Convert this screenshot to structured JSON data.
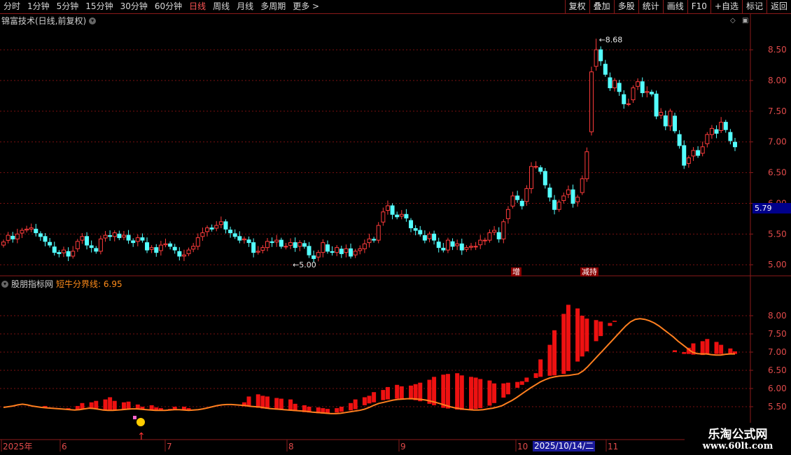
{
  "toolbar": {
    "periods": [
      "分时",
      "1分钟",
      "5分钟",
      "15分钟",
      "30分钟",
      "60分钟",
      "日线",
      "周线",
      "月线",
      "多周期",
      "更多 >"
    ],
    "active_period": "日线",
    "buttons": [
      "复权",
      "叠加",
      "多股",
      "统计",
      "画线",
      "F10",
      "+自选",
      "标记",
      "返回"
    ]
  },
  "main_panel": {
    "title": "锦富技术(日线,前复权)"
  },
  "sub_panel": {
    "name": "股朋指标网",
    "line_label": "短牛分界线: 6.95"
  },
  "current_price_tag": "5.79",
  "annotations": {
    "high": "8.68",
    "low": "5.00",
    "tag_zeng": "增",
    "tag_jigou": "减持"
  },
  "date_cursor": "2025/10/14/二",
  "watermark": {
    "line1": "乐淘公式网",
    "line2": "www.60lt.com"
  },
  "colors": {
    "up": "#ff3b3b",
    "down": "#54ffff",
    "bar": "#ee1111",
    "line": "#ff7f1f",
    "grid": "#7a1010"
  },
  "chart_data": [
    {
      "type": "candlestick",
      "title": "锦富技术(日线,前复权)",
      "y_ticks": [
        "8.50",
        "8.00",
        "7.50",
        "7.00",
        "6.50",
        "6.00",
        "5.50",
        "5.00"
      ],
      "ylim": [
        4.82,
        8.9
      ],
      "x_ticks": [
        "2025年",
        "6",
        "7",
        "8",
        "9",
        "10",
        "11"
      ],
      "series": [
        {
          "name": "K线",
          "close": [
            5.37,
            5.48,
            5.42,
            5.5,
            5.56,
            5.58,
            5.6,
            5.52,
            5.46,
            5.38,
            5.32,
            5.2,
            5.18,
            5.24,
            5.14,
            5.22,
            5.38,
            5.46,
            5.32,
            5.28,
            5.22,
            5.42,
            5.48,
            5.46,
            5.52,
            5.44,
            5.48,
            5.4,
            5.36,
            5.44,
            5.4,
            5.24,
            5.28,
            5.2,
            5.32,
            5.34,
            5.3,
            5.24,
            5.14,
            5.16,
            5.24,
            5.3,
            5.44,
            5.52,
            5.6,
            5.58,
            5.64,
            5.7,
            5.58,
            5.52,
            5.46,
            5.4,
            5.42,
            5.36,
            5.2,
            5.22,
            5.28,
            5.38,
            5.36,
            5.4,
            5.3,
            5.3,
            5.36,
            5.28,
            5.36,
            5.3,
            5.16,
            5.1,
            5.2,
            5.36,
            5.22,
            5.2,
            5.28,
            5.18,
            5.26,
            5.14,
            5.22,
            5.26,
            5.34,
            5.42,
            5.4,
            5.64,
            5.86,
            5.96,
            5.82,
            5.78,
            5.82,
            5.76,
            5.6,
            5.56,
            5.5,
            5.4,
            5.5,
            5.4,
            5.28,
            5.24,
            5.4,
            5.3,
            5.34,
            5.24,
            5.28,
            5.3,
            5.3,
            5.4,
            5.4,
            5.52,
            5.56,
            5.42,
            5.7,
            5.9,
            6.12,
            6.06,
            5.96,
            6.24,
            6.6,
            6.6,
            6.52,
            6.3,
            6.1,
            5.9,
            6.02,
            6.12,
            6.22,
            6.0,
            6.1,
            6.4,
            6.84,
            8.14,
            8.5,
            8.32,
            8.1,
            7.88,
            8.0,
            7.82,
            7.62,
            7.62,
            7.88,
            7.98,
            7.8,
            7.82,
            7.78,
            7.42,
            7.48,
            7.26,
            7.5,
            7.18,
            6.94,
            6.62,
            6.74,
            6.86,
            6.78,
            6.92,
            7.12,
            7.22,
            7.14,
            7.32,
            7.2,
            7.02,
            6.92
          ]
        }
      ],
      "high_annotation": 8.68,
      "low_annotation": 5.0
    },
    {
      "type": "bar",
      "title": "股朋指标网",
      "y_ticks": [
        "8.00",
        "7.50",
        "7.00",
        "6.50",
        "6.00",
        "5.50"
      ],
      "series": [
        {
          "name": "短牛分界线",
          "values": [
            5.48,
            5.5,
            5.52,
            5.55,
            5.57,
            5.55,
            5.52,
            5.5,
            5.48,
            5.47,
            5.46,
            5.45,
            5.44,
            5.43,
            5.42,
            5.41,
            5.42,
            5.44,
            5.46,
            5.45,
            5.43,
            5.41,
            5.4,
            5.4,
            5.41,
            5.42,
            5.43,
            5.44,
            5.44,
            5.43,
            5.42,
            5.41,
            5.4,
            5.4,
            5.4,
            5.41,
            5.42,
            5.42,
            5.41,
            5.4,
            5.41,
            5.42,
            5.44,
            5.47,
            5.5,
            5.53,
            5.55,
            5.56,
            5.56,
            5.55,
            5.54,
            5.53,
            5.51,
            5.5,
            5.49,
            5.47,
            5.45,
            5.44,
            5.43,
            5.42,
            5.41,
            5.4,
            5.39,
            5.38,
            5.37,
            5.35,
            5.34,
            5.33,
            5.32,
            5.31,
            5.31,
            5.32,
            5.34,
            5.36,
            5.38,
            5.4,
            5.43,
            5.48,
            5.54,
            5.59,
            5.62,
            5.65,
            5.68,
            5.7,
            5.71,
            5.72,
            5.72,
            5.71,
            5.7,
            5.68,
            5.65,
            5.62,
            5.58,
            5.54,
            5.5,
            5.47,
            5.45,
            5.43,
            5.42,
            5.41,
            5.41,
            5.42,
            5.44,
            5.46,
            5.49,
            5.53,
            5.6,
            5.67,
            5.75,
            5.84,
            5.93,
            6.02,
            6.1,
            6.18,
            6.24,
            6.29,
            6.32,
            6.34,
            6.35,
            6.36,
            6.38,
            6.4,
            6.48,
            6.6,
            6.74,
            6.88,
            7.02,
            7.16,
            7.3,
            7.44,
            7.58,
            7.72,
            7.83,
            7.9,
            7.92,
            7.9,
            7.86,
            7.8,
            7.72,
            7.62,
            7.52,
            7.42,
            7.3,
            7.2,
            7.1,
            7.0,
            6.96,
            6.95,
            6.95,
            6.93,
            6.92,
            6.92,
            6.94,
            6.95,
            6.95
          ]
        },
        {
          "name": "柱",
          "values": [
            5.48,
            5.46,
            5.4,
            5.5,
            5.44,
            5.46,
            5.52,
            5.46,
            5.42,
            5.4,
            5.46,
            5.52,
            5.6,
            5.62,
            5.66,
            5.7,
            5.76,
            5.66,
            5.62,
            5.64,
            5.56,
            5.5,
            5.54,
            5.48,
            5.46,
            5.44,
            5.5,
            5.5,
            5.46,
            5.44,
            5.4,
            5.36,
            5.34,
            5.36,
            5.4,
            5.44,
            5.62,
            5.78,
            5.84,
            5.8,
            5.78,
            5.74,
            5.72,
            5.7,
            5.58,
            5.54,
            5.5,
            5.48,
            5.46,
            5.44,
            5.46,
            5.5,
            5.6,
            5.7,
            5.76,
            5.8,
            5.9,
            5.96,
            6.04,
            6.1,
            6.06,
            6.08,
            6.12,
            6.16,
            6.24,
            6.32,
            6.38,
            6.4,
            6.42,
            6.36,
            6.32,
            6.3,
            6.26,
            6.22,
            6.14,
            6.14,
            6.16,
            6.18,
            6.2,
            6.3,
            6.42,
            6.8,
            7.2,
            7.6,
            8.05,
            8.3,
            8.2,
            8.0,
            7.92,
            7.88,
            7.84,
            7.8,
            7.86,
            7.82,
            7.74,
            7.68,
            7.52,
            7.4,
            7.3,
            7.2,
            7.1,
            7.05,
            7.0,
            7.12,
            7.24,
            7.3,
            7.36,
            7.28,
            7.2,
            7.1,
            7.02
          ]
        }
      ]
    }
  ]
}
